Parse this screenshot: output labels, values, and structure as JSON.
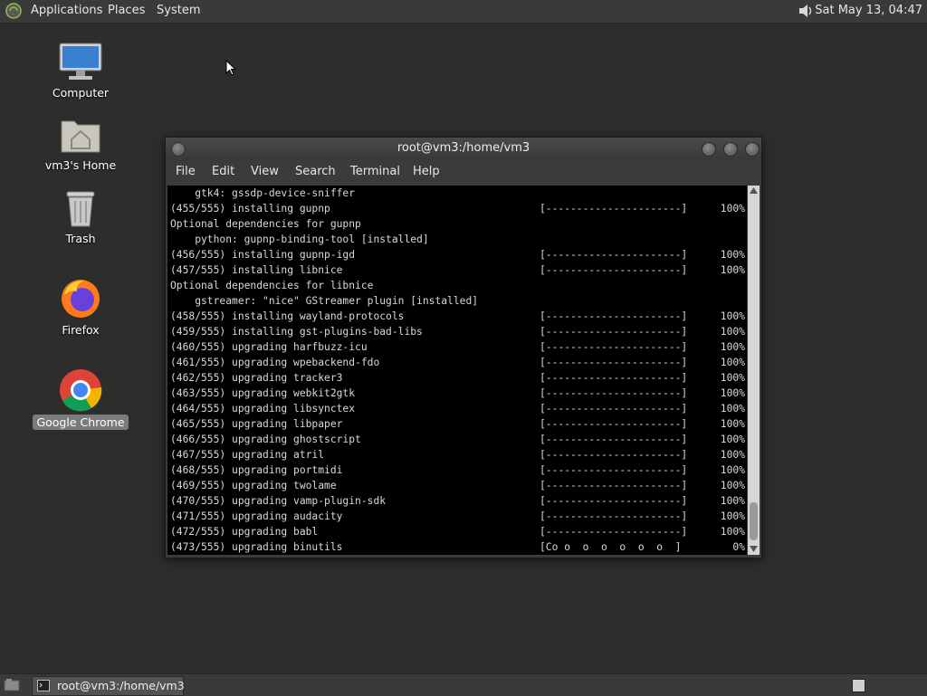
{
  "top_panel": {
    "menus": [
      "Applications",
      "Places",
      "System"
    ],
    "clock": "Sat May 13, 04:47"
  },
  "desktop": {
    "icons": [
      {
        "label": "Computer",
        "icon": "computer-icon"
      },
      {
        "label": "vm3's Home",
        "icon": "home-folder-icon"
      },
      {
        "label": "Trash",
        "icon": "trash-icon"
      },
      {
        "label": "Firefox",
        "icon": "firefox-icon"
      },
      {
        "label": "Google Chrome",
        "icon": "chrome-icon"
      }
    ]
  },
  "terminal": {
    "title": "root@vm3:/home/vm3",
    "menu": [
      "File",
      "Edit",
      "View",
      "Search",
      "Terminal",
      "Help"
    ],
    "lines": [
      {
        "text": "    gtk4: gssdp-device-sniffer",
        "bar": "",
        "pct": ""
      },
      {
        "text": "(455/555) installing gupnp",
        "bar": "[----------------------]",
        "pct": "100%"
      },
      {
        "text": "Optional dependencies for gupnp",
        "bar": "",
        "pct": ""
      },
      {
        "text": "    python: gupnp-binding-tool [installed]",
        "bar": "",
        "pct": ""
      },
      {
        "text": "(456/555) installing gupnp-igd",
        "bar": "[----------------------]",
        "pct": "100%"
      },
      {
        "text": "(457/555) installing libnice",
        "bar": "[----------------------]",
        "pct": "100%"
      },
      {
        "text": "Optional dependencies for libnice",
        "bar": "",
        "pct": ""
      },
      {
        "text": "    gstreamer: \"nice\" GStreamer plugin [installed]",
        "bar": "",
        "pct": ""
      },
      {
        "text": "(458/555) installing wayland-protocols",
        "bar": "[----------------------]",
        "pct": "100%"
      },
      {
        "text": "(459/555) installing gst-plugins-bad-libs",
        "bar": "[----------------------]",
        "pct": "100%"
      },
      {
        "text": "(460/555) upgrading harfbuzz-icu",
        "bar": "[----------------------]",
        "pct": "100%"
      },
      {
        "text": "(461/555) upgrading wpebackend-fdo",
        "bar": "[----------------------]",
        "pct": "100%"
      },
      {
        "text": "(462/555) upgrading tracker3",
        "bar": "[----------------------]",
        "pct": "100%"
      },
      {
        "text": "(463/555) upgrading webkit2gtk",
        "bar": "[----------------------]",
        "pct": "100%"
      },
      {
        "text": "(464/555) upgrading libsynctex",
        "bar": "[----------------------]",
        "pct": "100%"
      },
      {
        "text": "(465/555) upgrading libpaper",
        "bar": "[----------------------]",
        "pct": "100%"
      },
      {
        "text": "(466/555) upgrading ghostscript",
        "bar": "[----------------------]",
        "pct": "100%"
      },
      {
        "text": "(467/555) upgrading atril",
        "bar": "[----------------------]",
        "pct": "100%"
      },
      {
        "text": "(468/555) upgrading portmidi",
        "bar": "[----------------------]",
        "pct": "100%"
      },
      {
        "text": "(469/555) upgrading twolame",
        "bar": "[----------------------]",
        "pct": "100%"
      },
      {
        "text": "(470/555) upgrading vamp-plugin-sdk",
        "bar": "[----------------------]",
        "pct": "100%"
      },
      {
        "text": "(471/555) upgrading audacity",
        "bar": "[----------------------]",
        "pct": "100%"
      },
      {
        "text": "(472/555) upgrading babl",
        "bar": "[----------------------]",
        "pct": "100%"
      },
      {
        "text": "(473/555) upgrading binutils",
        "bar": "[Co o  o  o  o  o  o  ]",
        "pct": "0%"
      }
    ]
  },
  "taskbar": {
    "window_button": "root@vm3:/home/vm3"
  }
}
